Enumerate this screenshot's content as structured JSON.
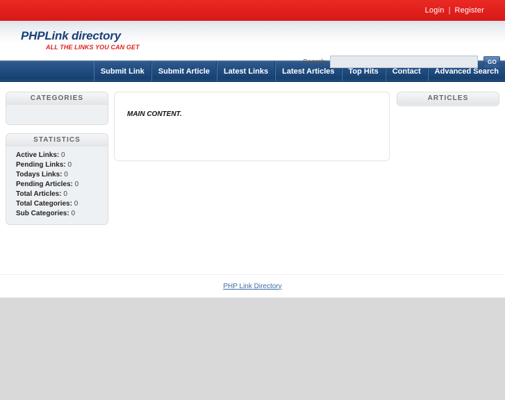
{
  "topbar": {
    "login_label": "Login",
    "separator": "|",
    "register_label": "Register"
  },
  "header": {
    "logo_main": "PHPLink directory",
    "logo_sub": "ALL THE LINKS YOU CAN GET",
    "search": {
      "label": "Search:",
      "value": "",
      "placeholder": "",
      "button_label": "GO"
    }
  },
  "nav": {
    "items": [
      {
        "label": "Submit Link"
      },
      {
        "label": "Submit Article"
      },
      {
        "label": "Latest Links"
      },
      {
        "label": "Latest Articles"
      },
      {
        "label": "Top Hits"
      },
      {
        "label": "Contact"
      },
      {
        "label": "Advanced Search"
      }
    ]
  },
  "sidebar_left": {
    "categories": {
      "title": "CATEGORIES",
      "items": []
    },
    "statistics": {
      "title": "STATISTICS",
      "rows": [
        {
          "key": "Active Links:",
          "value": "0"
        },
        {
          "key": "Pending Links:",
          "value": "0"
        },
        {
          "key": "Todays Links:",
          "value": "0"
        },
        {
          "key": "Pending Articles:",
          "value": "0"
        },
        {
          "key": "Total Articles:",
          "value": "0"
        },
        {
          "key": "Total Categories:",
          "value": "0"
        },
        {
          "key": "Sub Categories:",
          "value": "0"
        }
      ]
    }
  },
  "main": {
    "content_text": "MAIN CONTENT."
  },
  "sidebar_right": {
    "articles": {
      "title": "ARTICLES",
      "items": []
    }
  },
  "footer": {
    "link_label": "PHP Link Directory"
  },
  "colors": {
    "top_bar_red": "#e01f1c",
    "nav_blue": "#1e4a7e",
    "logo_blue": "#1b3f7a",
    "logo_red": "#e01f1c",
    "panel_bg": "#eef1f4",
    "page_grey": "#d9d9d9",
    "link_blue": "#3c6ba5"
  }
}
